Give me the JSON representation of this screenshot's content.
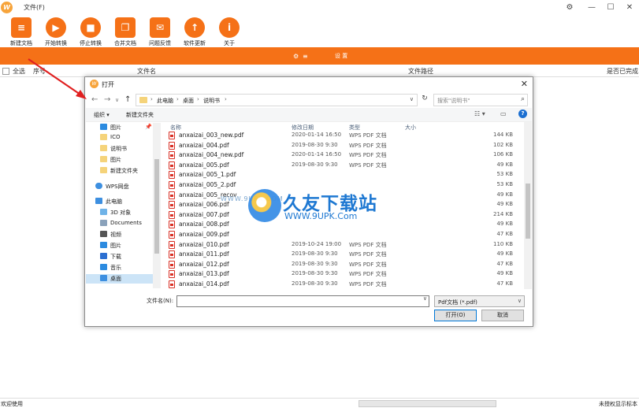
{
  "app": {
    "logo_letter": "W",
    "menu_file": "文件(F)",
    "window_controls": [
      "⚙",
      "—",
      "☐",
      "✕"
    ]
  },
  "toolbar": [
    {
      "label": "新建文档",
      "icon": "new-doc-icon",
      "glyph": "≡"
    },
    {
      "label": "开始转换",
      "icon": "play-icon",
      "glyph": "▶"
    },
    {
      "label": "停止转换",
      "icon": "stop-icon",
      "glyph": "■"
    },
    {
      "label": "合并文档",
      "icon": "merge-icon",
      "glyph": "❐"
    },
    {
      "label": "问题反馈",
      "icon": "feedback-icon",
      "glyph": "✉"
    },
    {
      "label": "软件更新",
      "icon": "update-icon",
      "glyph": "↑"
    },
    {
      "label": "关于",
      "icon": "info-icon",
      "glyph": "i"
    }
  ],
  "orange_bar": {
    "settings_label": "设 置"
  },
  "table": {
    "select_all": "全选",
    "columns": [
      "序号",
      "文件名",
      "文件路径",
      "是否已完成"
    ]
  },
  "status": {
    "left": "欢迎使用",
    "right": "未授权显示标本",
    "progress": 0
  },
  "dialog": {
    "title": "打开",
    "breadcrumbs": [
      "此电脑",
      "桌面",
      "说明书"
    ],
    "search_placeholder": "搜索\"说明书\"",
    "organize": "组织 ▾",
    "new_folder": "新建文件夹",
    "nav_items": [
      {
        "label": "图片",
        "color": "#2c8be0",
        "indent": 2,
        "pin": true
      },
      {
        "label": "ICO",
        "color": "#f5d37a",
        "indent": 2
      },
      {
        "label": "说明书",
        "color": "#f5d37a",
        "indent": 2
      },
      {
        "label": "图片",
        "color": "#f5d37a",
        "indent": 2
      },
      {
        "label": "新建文件夹",
        "color": "#f5d37a",
        "indent": 2
      },
      {
        "label": "WPS网盘",
        "color": "#3d8fe0",
        "indent": 1
      },
      {
        "label": "此电脑",
        "color": "#3d8fe0",
        "indent": 1
      },
      {
        "label": "3D 对象",
        "color": "#6fb3e8",
        "indent": 2
      },
      {
        "label": "Documents",
        "color": "#8aa2bb",
        "indent": 2
      },
      {
        "label": "视频",
        "color": "#555555",
        "indent": 2
      },
      {
        "label": "图片",
        "color": "#2c8be0",
        "indent": 2
      },
      {
        "label": "下载",
        "color": "#2c6fd1",
        "indent": 2
      },
      {
        "label": "音乐",
        "color": "#2c8be0",
        "indent": 2
      },
      {
        "label": "桌面",
        "color": "#3d8fe0",
        "indent": 2,
        "selected": true
      }
    ],
    "columns": {
      "name": "名称",
      "date": "修改日期",
      "type": "类型",
      "size": "大小"
    },
    "files": [
      {
        "name": "anxaizai_003_new.pdf",
        "date": "2020-01-14 16:50",
        "type": "WPS PDF 文档",
        "size": "144 KB"
      },
      {
        "name": "anxaizai_004.pdf",
        "date": "2019-08-30 9:30",
        "type": "WPS PDF 文档",
        "size": "102 KB"
      },
      {
        "name": "anxaizai_004_new.pdf",
        "date": "2020-01-14 16:50",
        "type": "WPS PDF 文档",
        "size": "106 KB"
      },
      {
        "name": "anxaizai_005.pdf",
        "date": "2019-08-30 9:30",
        "type": "WPS PDF 文档",
        "size": "49 KB"
      },
      {
        "name": "anxaizai_005_1.pdf",
        "date": "",
        "type": "",
        "size": "53 KB"
      },
      {
        "name": "anxaizai_005_2.pdf",
        "date": "",
        "type": "",
        "size": "53 KB"
      },
      {
        "name": "anxaizai_005_recov",
        "date": "",
        "type": "",
        "size": "49 KB"
      },
      {
        "name": "anxaizai_006.pdf",
        "date": "",
        "type": "",
        "size": "49 KB"
      },
      {
        "name": "anxaizai_007.pdf",
        "date": "",
        "type": "",
        "size": "214 KB"
      },
      {
        "name": "anxaizai_008.pdf",
        "date": "",
        "type": "",
        "size": "49 KB"
      },
      {
        "name": "anxaizai_009.pdf",
        "date": "",
        "type": "",
        "size": "47 KB"
      },
      {
        "name": "anxaizai_010.pdf",
        "date": "2019-10-24 19:00",
        "type": "WPS PDF 文档",
        "size": "110 KB"
      },
      {
        "name": "anxaizai_011.pdf",
        "date": "2019-08-30 9:30",
        "type": "WPS PDF 文档",
        "size": "49 KB"
      },
      {
        "name": "anxaizai_012.pdf",
        "date": "2019-08-30 9:30",
        "type": "WPS PDF 文档",
        "size": "47 KB"
      },
      {
        "name": "anxaizai_013.pdf",
        "date": "2019-08-30 9:30",
        "type": "WPS PDF 文档",
        "size": "49 KB"
      },
      {
        "name": "anxaizai_014.pdf",
        "date": "2019-08-30 9:30",
        "type": "WPS PDF 文档",
        "size": "47 KB"
      }
    ],
    "filename_label": "文件名(N):",
    "filename_value": "",
    "filter": "Pdf文档 (*.pdf)",
    "open_button": "打开(O)",
    "cancel_button": "取消"
  },
  "watermark": {
    "cn": "久友下载站",
    "url": "WWW.9UPK.Com",
    "ghost": "WWW.9UPK.COM"
  },
  "colors": {
    "accent": "#f57117",
    "watermark": "#1e78d2"
  }
}
